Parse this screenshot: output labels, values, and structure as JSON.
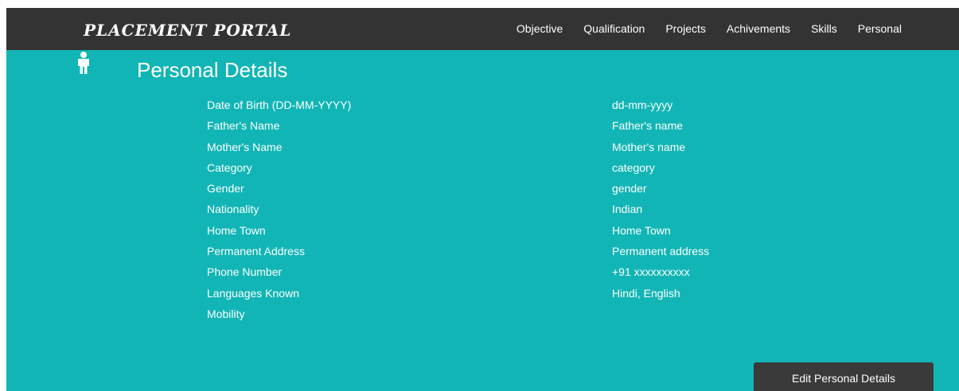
{
  "brand": "PLACEMENT PORTAL",
  "nav": [
    "Objective",
    "Qualification",
    "Projects",
    "Achivements",
    "Skills",
    "Personal"
  ],
  "page": {
    "icon": "person-icon",
    "title": "Personal Details"
  },
  "details": [
    {
      "label": "Date of Birth (DD-MM-YYYY)",
      "value": "dd-mm-yyyy"
    },
    {
      "label": "Father's Name",
      "value": "Father's name"
    },
    {
      "label": "Mother's Name",
      "value": "Mother's name"
    },
    {
      "label": "Category",
      "value": "category"
    },
    {
      "label": "Gender",
      "value": "gender"
    },
    {
      "label": "Nationality",
      "value": "Indian"
    },
    {
      "label": "Home Town",
      "value": "Home Town"
    },
    {
      "label": "Permanent Address",
      "value": "Permanent address"
    },
    {
      "label": "Phone Number",
      "value": "+91 xxxxxxxxxx"
    },
    {
      "label": "Languages Known",
      "value": "Hindi, English"
    },
    {
      "label": "Mobility",
      "value": ""
    }
  ],
  "edit_button": "Edit Personal Details",
  "colors": {
    "background": "#12b5b5",
    "navbar": "#333333",
    "button": "#3a3a3a",
    "text": "#ffffff"
  }
}
